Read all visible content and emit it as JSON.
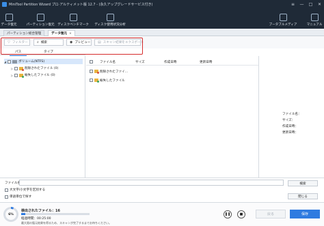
{
  "window": {
    "title": "MiniTool Partition Wizard プロ·アルティメット版 12.7 - (永久アップグレードサービス付き)",
    "controls": [
      "≡",
      "—",
      "□",
      "✕"
    ]
  },
  "ribbon": {
    "left": [
      "データ復元",
      "パーティション復元",
      "ディスクベンチマーク",
      "ディスク使用状況分析"
    ],
    "right": [
      "ブータブルメディア",
      "マニュアル"
    ]
  },
  "tabs": [
    {
      "label": "パーティション総合管理",
      "active": false
    },
    {
      "label": "データ復元",
      "active": true,
      "close": "×"
    }
  ],
  "toolbar": {
    "filter": "フィルター",
    "search": "検索",
    "preview": "プレビュー",
    "export": "スキャン結果をエクスポート"
  },
  "subtabs": [
    "パス",
    "タイプ"
  ],
  "tree": [
    {
      "label": "ボリューム(NTFS)",
      "level": 0,
      "expander": "◢",
      "icon": "disk",
      "selected": true
    },
    {
      "label": "削除されたファイル (0)",
      "level": 1,
      "expander": "▷",
      "icon": "folder-red"
    },
    {
      "label": "紛失したファイル (0)",
      "level": 1,
      "expander": "▷",
      "icon": "folder-green"
    }
  ],
  "file_list": {
    "headers": [
      "ファイル名",
      "サイズ",
      "作成日時",
      "更新日時"
    ],
    "rows": [
      {
        "name": "削除されたファイ...",
        "icon": "folder-red"
      },
      {
        "name": "紛失したファイル",
        "icon": "folder-green"
      }
    ]
  },
  "details": {
    "labels": [
      "ファイル名：",
      "サイズ：",
      "作成日時：",
      "更新日時："
    ]
  },
  "filter_area": {
    "filename_label": "ファイル名：",
    "filename_value": "",
    "search_button": "検索",
    "case_option": "大文字/小文字を区別する",
    "whole_word_option": "単語単位で探す",
    "close_button": "閉じる"
  },
  "status": {
    "progress_percent": 6,
    "progress_label": "6%",
    "found_label": "検出されたファイル：16",
    "elapsed_label": "経過時間：00:25:00",
    "note": "最大限の復元結果を得るため、スキャンが完了するまでお待ちください。",
    "pause_icon": "❚❚",
    "stop_icon": "■",
    "back_button": "戻る",
    "save_button": "保存",
    "accent_color": "#2f7be0"
  }
}
